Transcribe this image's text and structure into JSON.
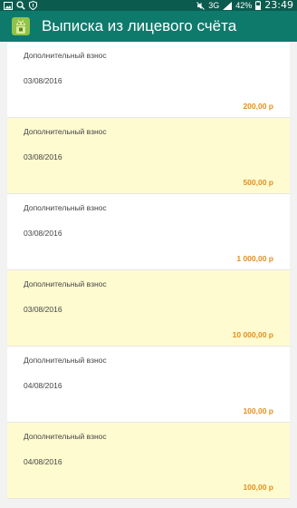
{
  "status_bar": {
    "icons": [
      "image-icon",
      "search-icon",
      "info-icon"
    ],
    "network_label": "3G",
    "battery_percent": "42%",
    "time": "23:49"
  },
  "app_bar": {
    "title": "Выписка из лицевого счёта",
    "logo_icon": "android-icon"
  },
  "entries": [
    {
      "type": "Дополнительный взнос",
      "date": "03/08/2016",
      "amount": "200,00 р",
      "highlight": false
    },
    {
      "type": "Дополнительный взнос",
      "date": "03/08/2016",
      "amount": "500,00 р",
      "highlight": true
    },
    {
      "type": "Дополнительный взнос",
      "date": "03/08/2016",
      "amount": "1 000,00 р",
      "highlight": false
    },
    {
      "type": "Дополнительный взнос",
      "date": "03/08/2016",
      "amount": "10 000,00 р",
      "highlight": true
    },
    {
      "type": "Дополнительный взнос",
      "date": "04/08/2016",
      "amount": "100,00 р",
      "highlight": false
    },
    {
      "type": "Дополнительный взнос",
      "date": "04/08/2016",
      "amount": "100,00 р",
      "highlight": true
    }
  ],
  "colors": {
    "status_bar": "#0b5b4f",
    "app_bar": "#0e7a6c",
    "highlight_row": "#fffbd0",
    "amount_text": "#e48f1f"
  }
}
